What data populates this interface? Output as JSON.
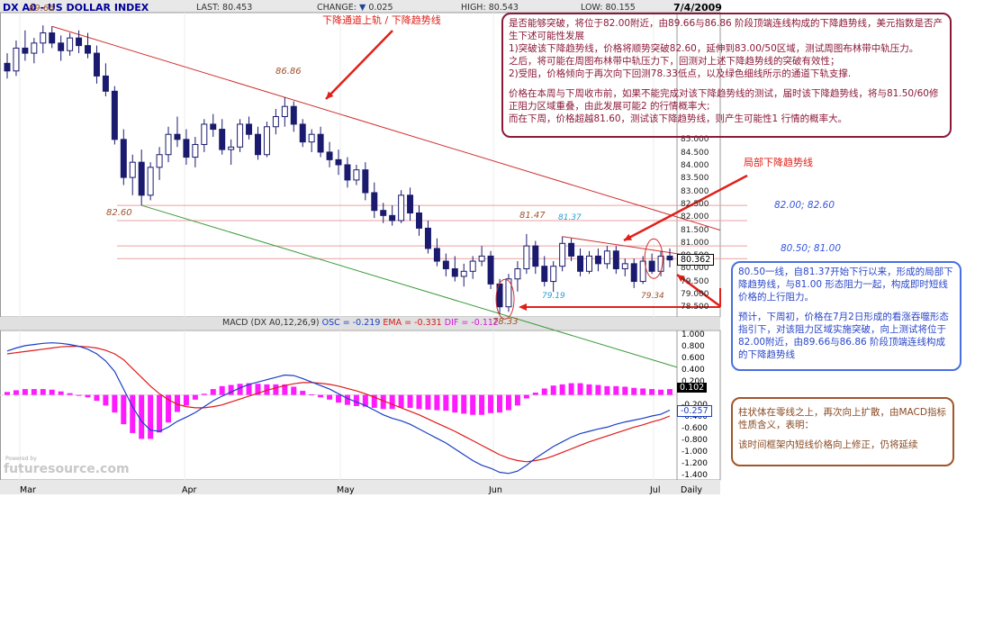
{
  "header": {
    "symbol": "DX A0",
    "name": "- US DOLLAR INDEX",
    "last_label": "LAST:",
    "last": "80.453",
    "change_label": "CHANGE:",
    "change": "0.025",
    "high_label": "HIGH:",
    "high": "80.543",
    "low_label": "LOW:",
    "low": "80.155",
    "date": "7/4/2009"
  },
  "price_panel": {
    "price_tag": "80.362",
    "y_ticks": [
      "85.000",
      "84.500",
      "84.000",
      "83.500",
      "83.000",
      "82.500",
      "82.000",
      "81.500",
      "81.000",
      "80.500",
      "80.000",
      "79.500",
      "79.000",
      "78.500"
    ],
    "annotations": {
      "p1": "89.66",
      "p2": "86.86",
      "p3": "82.60",
      "p4": "81.47",
      "p5": "81.37",
      "p6": "79.19",
      "p7": "79.34",
      "p8": "78.33",
      "channel_label": "下降通道上轨 / 下降趋势线",
      "local_label": "局部下降趋势线",
      "level1": "82.00; 82.60",
      "level2": "80.50; 81.00"
    }
  },
  "macd_panel": {
    "title": "MACD (DX A0,12,26,9)",
    "osc_label": "OSC = -0.219",
    "ema_label": "EMA = -0.331",
    "dif_label": "DIF = -0.112",
    "y_ticks": [
      "1.000",
      "0.800",
      "0.600",
      "0.400",
      "0.200",
      "-0.200",
      "-0.400",
      "-0.600",
      "-0.800",
      "-1.000",
      "-1.200",
      "-1.400"
    ],
    "tag_hist": "0.102",
    "tag_line": "-0.257"
  },
  "x_axis": {
    "months": [
      "Mar",
      "Apr",
      "May",
      "Jun",
      "Jul"
    ],
    "period": "Daily"
  },
  "watermark": {
    "powered": "Powered by",
    "brand": "futuresource.com"
  },
  "notes": {
    "top": [
      "是否能够突破，将位于82.00附近，由89.66与86.86 阶段顶端连线构成的下降趋势线，美元指数是否产生下述可能性发展",
      "1)突破该下降趋势线，价格将顺势突破82.60，延伸到83.00/50区域，测试周图布林带中轨压力。",
      "之后，将可能在周图布林带中轨压力下，回测对上述下降趋势线的突破有效性；",
      "2)受阻，价格倾向于再次向下回测78.33低点，以及绿色细线所示的通道下轨支撑.",
      "价格在本周与下周收市前，如果不能完成对该下降趋势线的测试，届时该下降趋势线，将与81.50/60修正阻力区域重叠，由此发展可能2 的行情概率大;",
      "而在下周，价格超越81.60，测试该下降趋势线，则产生可能性1 行情的概率大。"
    ],
    "blue": [
      "80.50一线，自81.37开始下行以来，形成的局部下降趋势线，与81.00 形态阻力一起，构成即时短线价格的上行阻力。",
      "预计，下周初，价格在7月2日形成的看涨吞噬形态指引下，对该阻力区域实施突破，向上测试将位于82.00附近，由89.66与86.86 阶段顶端连线构成的下降趋势线"
    ],
    "brown": [
      "柱状体在零线之上，再次向上扩散，由MACD指标性质含义，表明：",
      "该时间框架内短线价格向上修正，仍将延续"
    ]
  },
  "chart_data": {
    "type": "candlestick",
    "title": "DX A0 - US DOLLAR INDEX",
    "ylim": [
      78.2,
      90.2
    ],
    "candles": [
      [
        88.2,
        88.6,
        87.6,
        87.9
      ],
      [
        87.9,
        89.1,
        87.7,
        88.8
      ],
      [
        88.8,
        89.5,
        88.3,
        88.6
      ],
      [
        88.6,
        89.2,
        88.2,
        89.0
      ],
      [
        89.0,
        89.7,
        88.6,
        89.4
      ],
      [
        89.4,
        89.66,
        88.8,
        89.0
      ],
      [
        89.0,
        89.3,
        88.3,
        88.7
      ],
      [
        88.7,
        89.4,
        88.5,
        89.2
      ],
      [
        89.2,
        89.5,
        88.6,
        88.9
      ],
      [
        88.9,
        89.4,
        88.4,
        88.6
      ],
      [
        88.6,
        88.9,
        87.4,
        87.7
      ],
      [
        87.7,
        88.2,
        86.9,
        87.1
      ],
      [
        87.1,
        87.3,
        85.0,
        85.2
      ],
      [
        85.2,
        85.6,
        83.4,
        83.7
      ],
      [
        83.7,
        84.6,
        83.0,
        84.3
      ],
      [
        84.3,
        84.8,
        82.6,
        83.0
      ],
      [
        83.0,
        84.3,
        82.8,
        84.1
      ],
      [
        84.1,
        84.9,
        83.6,
        84.6
      ],
      [
        84.6,
        85.7,
        84.3,
        85.4
      ],
      [
        85.4,
        86.1,
        84.9,
        85.2
      ],
      [
        85.2,
        85.6,
        84.2,
        84.5
      ],
      [
        84.5,
        85.3,
        84.1,
        85.0
      ],
      [
        85.0,
        86.0,
        84.7,
        85.8
      ],
      [
        85.8,
        86.2,
        85.3,
        85.6
      ],
      [
        85.6,
        86.0,
        84.6,
        84.8
      ],
      [
        84.8,
        85.2,
        84.2,
        84.9
      ],
      [
        84.9,
        86.0,
        84.7,
        85.8
      ],
      [
        85.8,
        86.1,
        85.2,
        85.4
      ],
      [
        85.4,
        85.7,
        84.4,
        84.6
      ],
      [
        84.6,
        85.9,
        84.5,
        85.7
      ],
      [
        85.7,
        86.4,
        85.4,
        86.1
      ],
      [
        86.1,
        86.86,
        85.7,
        86.5
      ],
      [
        86.5,
        86.7,
        85.5,
        85.8
      ],
      [
        85.8,
        86.0,
        84.9,
        85.1
      ],
      [
        85.1,
        85.6,
        84.7,
        85.4
      ],
      [
        85.4,
        85.7,
        84.5,
        84.7
      ],
      [
        84.7,
        85.1,
        84.1,
        84.4
      ],
      [
        84.4,
        84.8,
        83.8,
        84.2
      ],
      [
        84.2,
        84.5,
        83.3,
        83.6
      ],
      [
        83.6,
        84.2,
        83.4,
        84.0
      ],
      [
        84.0,
        84.3,
        82.8,
        83.1
      ],
      [
        83.1,
        83.5,
        82.1,
        82.4
      ],
      [
        82.4,
        82.7,
        81.9,
        82.2
      ],
      [
        82.2,
        82.6,
        81.8,
        82.0
      ],
      [
        82.0,
        83.2,
        81.9,
        83.0
      ],
      [
        83.0,
        83.3,
        82.0,
        82.3
      ],
      [
        82.3,
        82.6,
        81.4,
        81.7
      ],
      [
        81.7,
        82.0,
        80.7,
        80.9
      ],
      [
        80.9,
        81.3,
        80.2,
        80.4
      ],
      [
        80.4,
        80.7,
        79.8,
        80.1
      ],
      [
        80.1,
        80.6,
        79.6,
        79.8
      ],
      [
        79.8,
        80.3,
        79.4,
        80.0
      ],
      [
        80.0,
        80.6,
        79.7,
        80.4
      ],
      [
        80.4,
        81.0,
        80.2,
        80.6
      ],
      [
        80.6,
        80.8,
        79.3,
        79.5
      ],
      [
        79.5,
        79.7,
        78.33,
        78.6
      ],
      [
        78.6,
        79.9,
        78.4,
        79.7
      ],
      [
        79.7,
        80.4,
        79.2,
        80.1
      ],
      [
        80.1,
        81.47,
        79.9,
        81.0
      ],
      [
        81.0,
        81.2,
        79.9,
        80.2
      ],
      [
        80.2,
        80.6,
        79.4,
        79.6
      ],
      [
        79.6,
        80.4,
        79.19,
        80.2
      ],
      [
        80.2,
        81.37,
        80.0,
        81.1
      ],
      [
        81.1,
        81.3,
        80.4,
        80.6
      ],
      [
        80.6,
        80.9,
        79.8,
        80.0
      ],
      [
        80.0,
        80.8,
        79.9,
        80.6
      ],
      [
        80.6,
        80.9,
        80.0,
        80.3
      ],
      [
        80.3,
        81.0,
        80.1,
        80.8
      ],
      [
        80.8,
        81.0,
        79.9,
        80.1
      ],
      [
        80.1,
        80.5,
        79.8,
        80.3
      ],
      [
        80.3,
        80.5,
        79.34,
        79.6
      ],
      [
        79.6,
        80.6,
        79.5,
        80.4
      ],
      [
        80.4,
        80.7,
        79.9,
        80.0
      ],
      [
        80.0,
        80.8,
        79.8,
        80.6
      ],
      [
        80.6,
        80.9,
        80.155,
        80.45
      ]
    ],
    "macd": {
      "ylim": [
        -1.45,
        1.1
      ],
      "dif": [
        0.75,
        0.8,
        0.84,
        0.86,
        0.88,
        0.89,
        0.88,
        0.86,
        0.83,
        0.78,
        0.7,
        0.58,
        0.4,
        0.1,
        -0.2,
        -0.45,
        -0.6,
        -0.62,
        -0.55,
        -0.45,
        -0.38,
        -0.3,
        -0.2,
        -0.1,
        -0.02,
        0.05,
        0.12,
        0.18,
        0.22,
        0.26,
        0.3,
        0.34,
        0.33,
        0.28,
        0.22,
        0.16,
        0.1,
        0.02,
        -0.06,
        -0.12,
        -0.18,
        -0.26,
        -0.34,
        -0.4,
        -0.44,
        -0.5,
        -0.58,
        -0.66,
        -0.74,
        -0.82,
        -0.92,
        -1.02,
        -1.12,
        -1.2,
        -1.25,
        -1.32,
        -1.34,
        -1.3,
        -1.2,
        -1.08,
        -0.98,
        -0.88,
        -0.8,
        -0.72,
        -0.66,
        -0.62,
        -0.58,
        -0.55,
        -0.5,
        -0.46,
        -0.43,
        -0.4,
        -0.36,
        -0.33,
        -0.26
      ],
      "ema": [
        0.7,
        0.72,
        0.74,
        0.76,
        0.78,
        0.8,
        0.82,
        0.83,
        0.83,
        0.82,
        0.8,
        0.76,
        0.7,
        0.6,
        0.45,
        0.3,
        0.15,
        0.02,
        -0.08,
        -0.16,
        -0.2,
        -0.22,
        -0.22,
        -0.2,
        -0.17,
        -0.12,
        -0.07,
        -0.02,
        0.03,
        0.08,
        0.12,
        0.16,
        0.19,
        0.21,
        0.21,
        0.2,
        0.18,
        0.15,
        0.11,
        0.07,
        0.02,
        -0.04,
        -0.1,
        -0.16,
        -0.22,
        -0.28,
        -0.34,
        -0.41,
        -0.48,
        -0.55,
        -0.62,
        -0.7,
        -0.78,
        -0.86,
        -0.94,
        -1.02,
        -1.08,
        -1.12,
        -1.14,
        -1.12,
        -1.09,
        -1.04,
        -0.98,
        -0.92,
        -0.86,
        -0.8,
        -0.75,
        -0.7,
        -0.65,
        -0.6,
        -0.55,
        -0.51,
        -0.46,
        -0.42,
        -0.36
      ],
      "hist": [
        0.05,
        0.08,
        0.1,
        0.1,
        0.1,
        0.09,
        0.06,
        0.03,
        0.0,
        -0.04,
        -0.1,
        -0.18,
        -0.3,
        -0.5,
        -0.65,
        -0.75,
        -0.75,
        -0.64,
        -0.47,
        -0.29,
        -0.18,
        -0.08,
        0.02,
        0.1,
        0.15,
        0.17,
        0.19,
        0.2,
        0.19,
        0.18,
        0.18,
        0.18,
        0.14,
        0.07,
        0.01,
        -0.04,
        -0.08,
        -0.13,
        -0.17,
        -0.19,
        -0.2,
        -0.22,
        -0.24,
        -0.24,
        -0.22,
        -0.22,
        -0.24,
        -0.25,
        -0.26,
        -0.27,
        -0.3,
        -0.32,
        -0.34,
        -0.34,
        -0.31,
        -0.3,
        -0.26,
        -0.18,
        -0.06,
        0.04,
        0.11,
        0.16,
        0.18,
        0.2,
        0.2,
        0.18,
        0.17,
        0.15,
        0.15,
        0.14,
        0.12,
        0.11,
        0.1,
        0.09,
        0.1
      ]
    }
  }
}
